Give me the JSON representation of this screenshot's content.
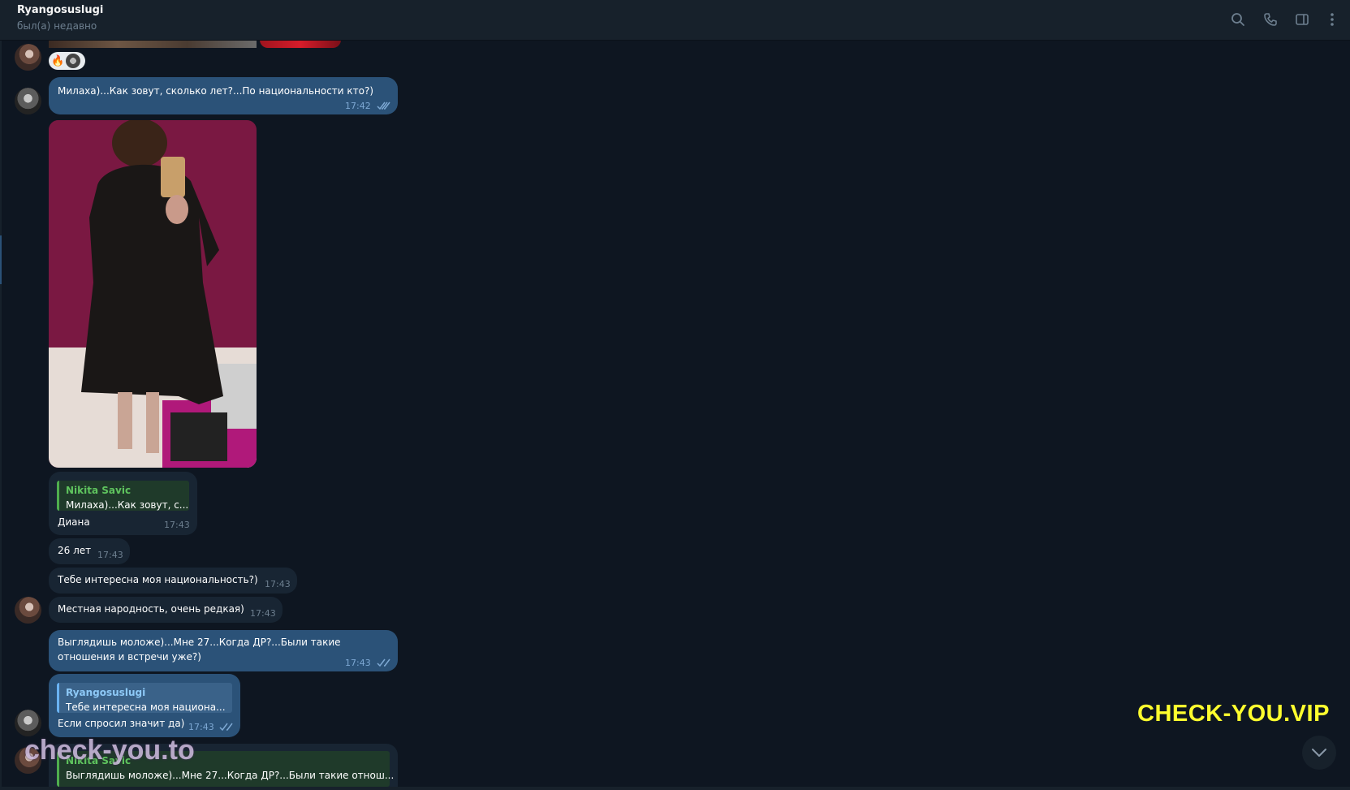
{
  "header": {
    "title": "Ryangosuslugi",
    "status": "был(а) недавно",
    "icons": [
      "search-icon",
      "phone-icon",
      "sidebar-toggle-icon",
      "more-icon"
    ]
  },
  "colors": {
    "background": "#0e1621",
    "incoming_bubble": "#182533",
    "outgoing_bubble": "#2b5278",
    "time_incoming": "#6d7f8f",
    "time_outgoing": "#7da8d3",
    "reply_name_incoming": "#5fc45e",
    "watermark_yellow": "#ffff2e"
  },
  "messages": {
    "m1": {
      "text": "Милаха)...Как зовут, сколько лет?...По национальности кто?)",
      "time": "17:42"
    },
    "m2": {
      "reply_name": "Nikita Savic",
      "reply_text": "Милаха)...Как зовут, с...",
      "text": "Диана",
      "time": "17:43"
    },
    "m3": {
      "text": "26 лет",
      "time": "17:43"
    },
    "m4": {
      "text": "Тебе интересна моя национальность?)",
      "time": "17:43"
    },
    "m5": {
      "text": "Местная народность, очень редкая)",
      "time": "17:43"
    },
    "m6": {
      "line1": "Выглядишь моложе)...Мне 27...Когда ДР?...Были такие",
      "line2": "отношения и встречи уже?)",
      "time": "17:43"
    },
    "m7": {
      "reply_name": "Ryangosuslugi",
      "reply_text": "Тебе интересна моя национа...",
      "text": "Если спросил значит да)",
      "time": "17:43"
    },
    "m8": {
      "reply_name": "Nikita Savic",
      "reply_text": "Выглядишь моложе)...Мне 27...Когда ДР?...Были такие отнош..."
    }
  },
  "reactions": [
    "🔥"
  ],
  "watermarks": {
    "right": "CHECK-YOU.VIP",
    "left": "check-you.to"
  }
}
